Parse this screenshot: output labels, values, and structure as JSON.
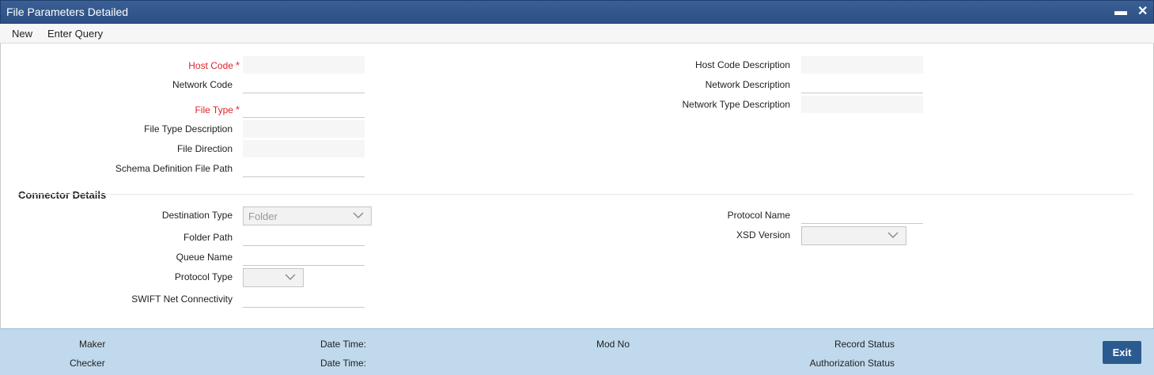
{
  "window": {
    "title": "File Parameters Detailed",
    "minimize_glyph": "▬",
    "close_glyph": "✕"
  },
  "menu": {
    "items": [
      "New",
      "Enter Query"
    ]
  },
  "form": {
    "host_code": {
      "label": "Host Code",
      "value": "",
      "required": true
    },
    "network_code": {
      "label": "Network Code",
      "value": ""
    },
    "file_type": {
      "label": "File Type",
      "value": "",
      "required": true
    },
    "file_type_description": {
      "label": "File Type Description",
      "value": ""
    },
    "file_direction": {
      "label": "File Direction",
      "value": ""
    },
    "schema_path": {
      "label": "Schema Definition File Path",
      "value": ""
    },
    "host_code_description": {
      "label": "Host Code Description",
      "value": ""
    },
    "network_description": {
      "label": "Network Description",
      "value": ""
    },
    "network_type_description": {
      "label": "Network Type Description",
      "value": ""
    },
    "required_marker": "*"
  },
  "connector": {
    "section_title": "Connector Details",
    "destination_type": {
      "label": "Destination Type",
      "value": "Folder"
    },
    "folder_path": {
      "label": "Folder Path",
      "value": ""
    },
    "queue_name": {
      "label": "Queue Name",
      "value": ""
    },
    "protocol_type": {
      "label": "Protocol Type",
      "value": ""
    },
    "swift_net": {
      "label": "SWIFT Net Connectivity",
      "value": ""
    },
    "protocol_name": {
      "label": "Protocol Name",
      "value": ""
    },
    "xsd_version": {
      "label": "XSD Version",
      "value": ""
    }
  },
  "footer": {
    "maker": "Maker",
    "checker": "Checker",
    "date_time_1": "Date Time:",
    "date_time_2": "Date Time:",
    "mod_no": "Mod No",
    "record_status": "Record Status",
    "authorization_status": "Authorization Status",
    "exit": "Exit"
  },
  "colors": {
    "title_bar": "#2c5085",
    "required": "#e0232b",
    "footer_bg": "#c0d9ec",
    "exit_button": "#2b5a8f"
  }
}
